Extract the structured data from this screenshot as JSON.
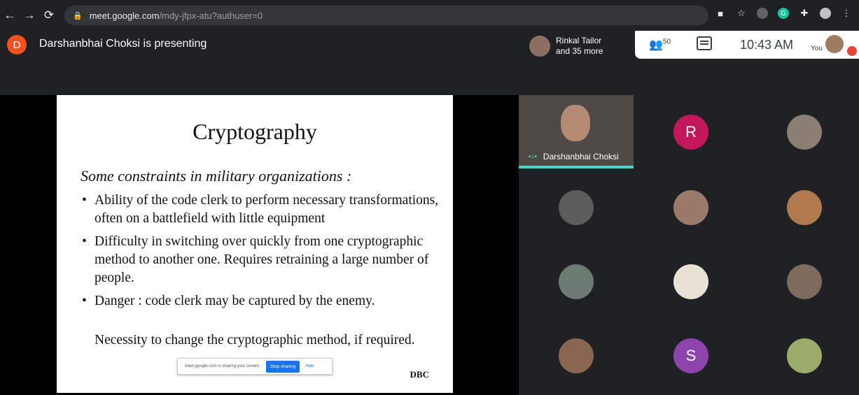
{
  "browser": {
    "url_host": "meet.google.com",
    "url_path": "/mdy-jfpx-atu?authuser=0"
  },
  "meeting": {
    "presenter_initial": "D",
    "presenting_text": "Darshanbhai Choksi is presenting",
    "people_chip_line1": "Rinkal Tailor",
    "people_chip_line2": "and 35 more",
    "participant_count": "50",
    "time": "10:43 AM",
    "you_label": "You"
  },
  "slide": {
    "title": "Cryptography",
    "subtitle": "Some constraints in military organizations :",
    "bullets": [
      "Ability of the code clerk to perform necessary transformations, often on a battlefield with little equipment",
      "Difficulty in switching over quickly from one cryptographic method to another one. Requires retraining a large number of people.",
      "Danger : code clerk may be captured by the enemy."
    ],
    "continuation": "Necessity to change the cryptographic method, if required.",
    "footer": "DBC"
  },
  "share_bar": {
    "text": "meet.google.com is sharing your screen.",
    "stop_label": "Stop sharing",
    "hide_label": "Hide"
  },
  "participants": {
    "active_speaker_name": "Darshanbhai Choksi",
    "tile_2_initial": "R",
    "tile_13_initial": "S"
  },
  "colors": {
    "presenter_avatar": "#f4511e",
    "r_avatar": "#c2185b",
    "s_avatar": "#8e44ad",
    "speaking_accent": "#4fd1c5"
  }
}
